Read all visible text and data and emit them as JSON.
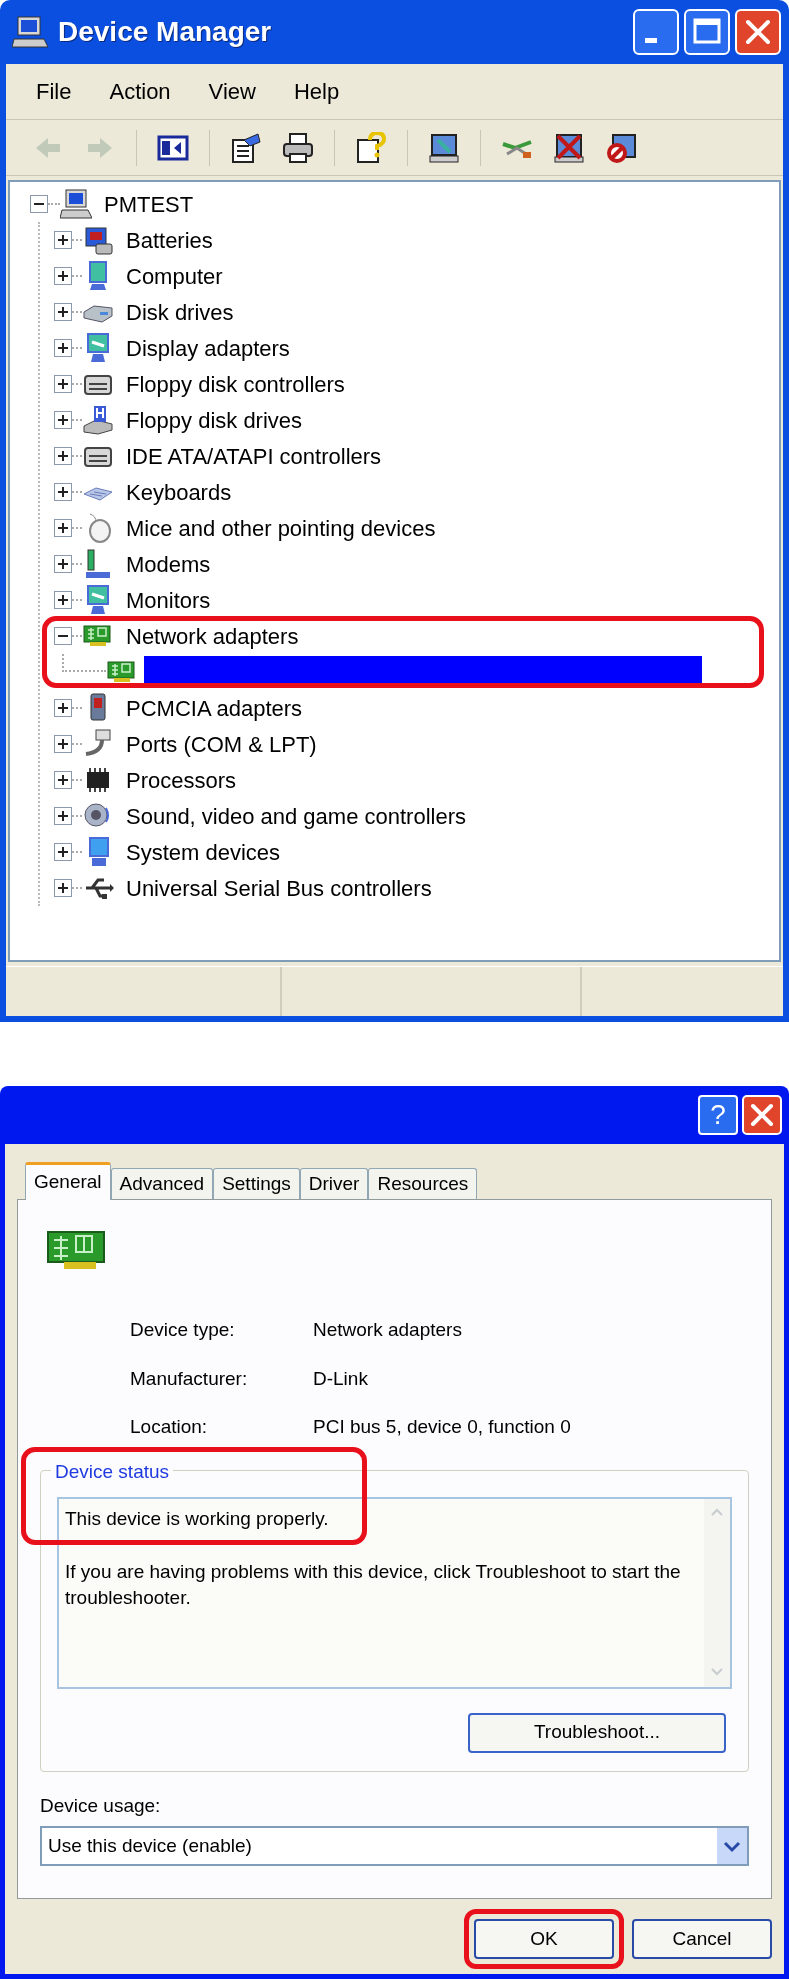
{
  "device_manager": {
    "title": "Device Manager",
    "menu": [
      "File",
      "Action",
      "View",
      "Help"
    ],
    "toolbar": [
      {
        "disabled": true
      },
      {
        "disabled": true
      },
      {
        "disabled": false
      },
      {
        "disabled": false
      },
      {
        "disabled": false
      },
      {
        "disabled": false
      },
      {
        "disabled": false
      },
      {
        "disabled": false
      },
      {
        "disabled": false
      },
      {
        "disabled": false
      }
    ],
    "tree": {
      "label": "PMTEST",
      "expanded": true,
      "selected": false,
      "children": [
        {
          "label": "Batteries",
          "expanded": false,
          "selected": false
        },
        {
          "label": "Computer",
          "expanded": false,
          "selected": false
        },
        {
          "label": "Disk drives",
          "expanded": false,
          "selected": false
        },
        {
          "label": "Display adapters",
          "expanded": false,
          "selected": false
        },
        {
          "label": "Floppy disk controllers",
          "expanded": false,
          "selected": false
        },
        {
          "label": "Floppy disk drives",
          "expanded": false,
          "selected": false
        },
        {
          "label": "IDE ATA/ATAPI controllers",
          "expanded": false,
          "selected": false
        },
        {
          "label": "Keyboards",
          "expanded": false,
          "selected": false
        },
        {
          "label": "Mice and other pointing devices",
          "expanded": false,
          "selected": false
        },
        {
          "label": "Modems",
          "expanded": false,
          "selected": false
        },
        {
          "label": "Monitors",
          "expanded": false,
          "selected": false
        },
        {
          "label": "Network adapters",
          "expanded": true,
          "selected": false,
          "highlighted": true,
          "children": [
            {
              "selected": true
            }
          ]
        },
        {
          "label": "PCMCIA adapters",
          "expanded": false,
          "selected": false
        },
        {
          "label": "Ports (COM & LPT)",
          "expanded": false,
          "selected": false
        },
        {
          "label": "Processors",
          "expanded": false,
          "selected": false
        },
        {
          "label": "Sound, video and game controllers",
          "expanded": false,
          "selected": false
        },
        {
          "label": "System devices",
          "expanded": false,
          "selected": false
        },
        {
          "label": "Universal Serial Bus controllers",
          "expanded": false,
          "selected": false
        }
      ]
    }
  },
  "properties_dialog": {
    "help_button": "?",
    "tabs": [
      {
        "label": "General",
        "selected": true
      },
      {
        "label": "Advanced",
        "selected": false
      },
      {
        "label": "Settings",
        "selected": false
      },
      {
        "label": "Driver",
        "selected": false
      },
      {
        "label": "Resources",
        "selected": false
      }
    ],
    "fields": [
      {
        "label": "Device type:",
        "value": "Network adapters"
      },
      {
        "label": "Manufacturer:",
        "value": "D-Link"
      },
      {
        "label": "Location:",
        "value": "PCI bus 5, device 0, function 0"
      }
    ],
    "device_status": {
      "label": "Device status",
      "status": "This device is working properly.",
      "highlighted": true,
      "message": "If you are having problems with this device, click Troubleshoot to start the troubleshooter."
    },
    "troubleshoot_button": "Troubleshoot...",
    "device_usage": {
      "label": "Device usage:",
      "value": "Use this device (enable)"
    },
    "buttons": [
      {
        "label": "OK",
        "highlighted": true
      },
      {
        "label": "Cancel"
      }
    ]
  }
}
